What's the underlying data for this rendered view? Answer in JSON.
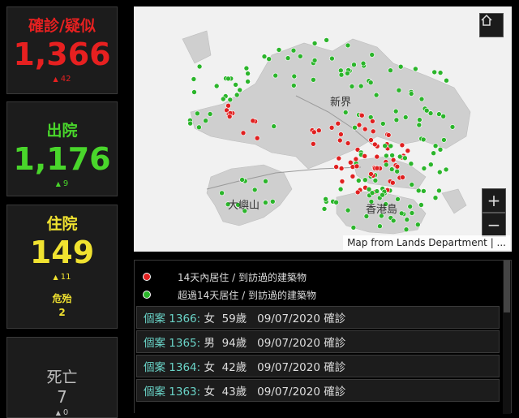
{
  "confirmed": {
    "title": "確診/疑似",
    "value": "1,366",
    "delta": "42",
    "color": "#e62020"
  },
  "discharged": {
    "title": "出院",
    "value": "1,176",
    "delta": "9",
    "color": "#49d62b"
  },
  "hospitalized": {
    "title": "住院",
    "value": "149",
    "delta": "11",
    "critical_label": "危殆",
    "critical_value": "2",
    "color": "#f0e230"
  },
  "death": {
    "title": "死亡",
    "value": "7",
    "delta": "0",
    "color": "#bfbfbf"
  },
  "map": {
    "labels": {
      "new_territories": "新界",
      "lantau": "大嶼山",
      "hk_island": "香港島"
    },
    "attribution": "Map from Lands Department | ...",
    "home_icon": "home-icon",
    "zoom_in": "+",
    "zoom_out": "−"
  },
  "legend": [
    {
      "color": "#e02020",
      "label": "14天內居住 / 到訪過的建築物"
    },
    {
      "color": "#2bb52b",
      "label": "超過14天居住 / 到訪過的建築物"
    }
  ],
  "cases": [
    {
      "id": "個案 1366:",
      "details": " 女  59歲   09/07/2020 確診"
    },
    {
      "id": "個案 1365:",
      "details": " 男  94歲   09/07/2020 確診"
    },
    {
      "id": "個案 1364:",
      "details": " 女  42歲   09/07/2020 確診"
    },
    {
      "id": "個案 1363:",
      "details": " 女  43歲   09/07/2020 確診"
    }
  ]
}
